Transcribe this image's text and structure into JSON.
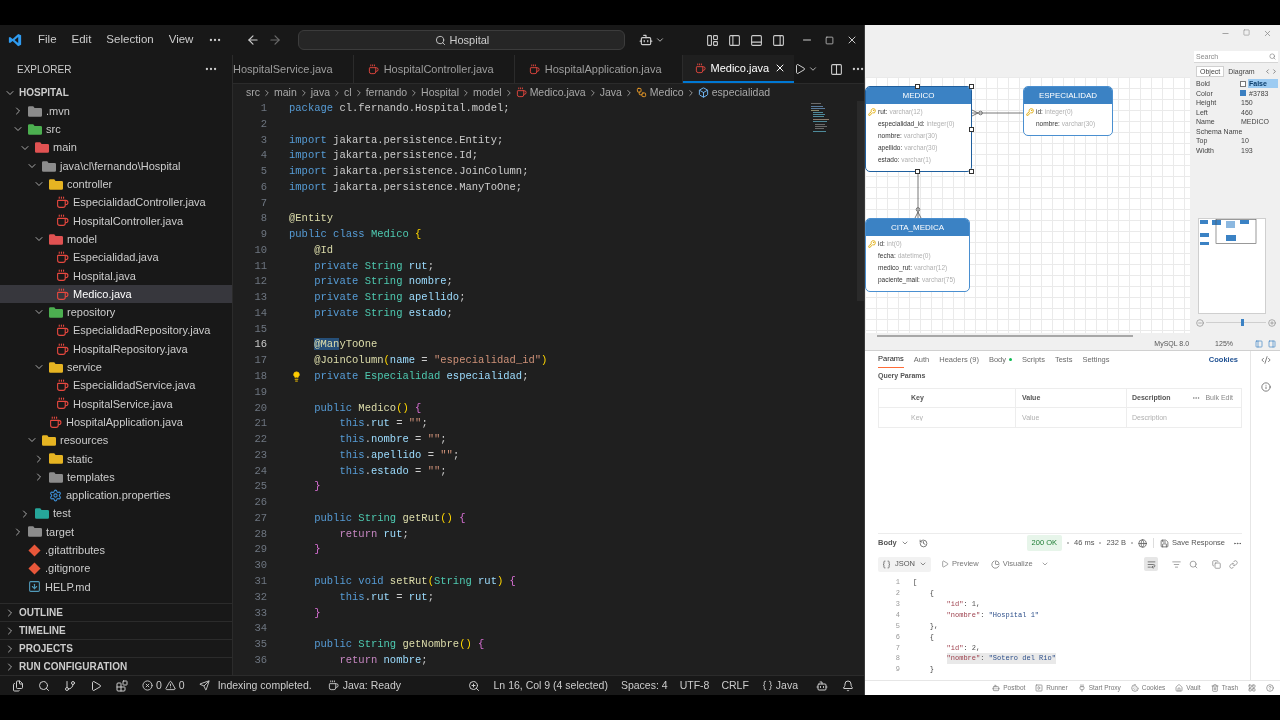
{
  "vscode": {
    "menu": [
      "File",
      "Edit",
      "Selection",
      "View"
    ],
    "command_center": "Hospital",
    "sidebar": {
      "title": "EXPLORER",
      "project": {
        "label": "HOSPITAL",
        "expanded": true
      },
      "tree": [
        {
          "label": ".mvn",
          "kind": "folder",
          "color": "#8c8c8c",
          "expanded": false,
          "selected": false
        },
        {
          "label": "src",
          "kind": "folder",
          "color": "#4caf50",
          "expanded": true,
          "selected": false,
          "children": [
            {
              "label": "main",
              "kind": "folder",
              "color": "#e05252",
              "expanded": true,
              "selected": false,
              "children": [
                {
                  "label": "java\\cl\\fernando\\Hospital",
                  "kind": "folder",
                  "color": "#8c8c8c",
                  "expanded": true,
                  "selected": false,
                  "children": [
                    {
                      "label": "controller",
                      "kind": "folder",
                      "color": "#e6b422",
                      "expanded": true,
                      "selected": false,
                      "children": [
                        {
                          "label": "EspecialidadController.java",
                          "kind": "java",
                          "selected": false
                        },
                        {
                          "label": "HospitalController.java",
                          "kind": "java",
                          "selected": false
                        }
                      ]
                    },
                    {
                      "label": "model",
                      "kind": "folder",
                      "color": "#e05252",
                      "expanded": true,
                      "selected": false,
                      "children": [
                        {
                          "label": "Especialidad.java",
                          "kind": "java",
                          "selected": false
                        },
                        {
                          "label": "Hospital.java",
                          "kind": "java",
                          "selected": false
                        },
                        {
                          "label": "Medico.java",
                          "kind": "java",
                          "selected": true
                        }
                      ]
                    },
                    {
                      "label": "repository",
                      "kind": "folder",
                      "color": "#4caf50",
                      "expanded": true,
                      "selected": false,
                      "children": [
                        {
                          "label": "EspecialidadRepository.java",
                          "kind": "java",
                          "selected": false
                        },
                        {
                          "label": "HospitalRepository.java",
                          "kind": "java",
                          "selected": false
                        }
                      ]
                    },
                    {
                      "label": "service",
                      "kind": "folder",
                      "color": "#e6b422",
                      "expanded": true,
                      "selected": false,
                      "children": [
                        {
                          "label": "EspecialidadService.java",
                          "kind": "java",
                          "selected": false
                        },
                        {
                          "label": "HospitalService.java",
                          "kind": "java",
                          "selected": false
                        }
                      ]
                    },
                    {
                      "label": "HospitalApplication.java",
                      "kind": "java",
                      "selected": false
                    }
                  ]
                },
                {
                  "label": "resources",
                  "kind": "folder",
                  "color": "#e6b422",
                  "expanded": true,
                  "selected": false,
                  "children": [
                    {
                      "label": "static",
                      "kind": "folder",
                      "color": "#e6b422",
                      "expanded": false,
                      "selected": false
                    },
                    {
                      "label": "templates",
                      "kind": "folder",
                      "color": "#8c8c8c",
                      "expanded": false,
                      "selected": false
                    },
                    {
                      "label": "application.properties",
                      "kind": "properties",
                      "selected": false
                    }
                  ]
                }
              ]
            },
            {
              "label": "test",
              "kind": "folder",
              "color": "#26a69a",
              "expanded": false,
              "selected": false
            }
          ]
        },
        {
          "label": "target",
          "kind": "folder",
          "color": "#8c8c8c",
          "expanded": false,
          "selected": false
        },
        {
          "label": ".gitattributes",
          "kind": "git",
          "selected": false
        },
        {
          "label": ".gitignore",
          "kind": "git",
          "selected": false
        },
        {
          "label": "HELP.md",
          "kind": "markdown",
          "selected": false
        }
      ],
      "sections": [
        {
          "label": "OUTLINE",
          "expanded": false
        },
        {
          "label": "TIMELINE",
          "expanded": false
        },
        {
          "label": "PROJECTS",
          "expanded": false
        },
        {
          "label": "RUN CONFIGURATION",
          "expanded": false
        }
      ]
    },
    "tabs": [
      {
        "label": "HospitalService.java",
        "selected": false,
        "partly_hidden": true
      },
      {
        "label": "HospitalController.java",
        "selected": false,
        "partly_hidden": false
      },
      {
        "label": "HospitalApplication.java",
        "selected": false,
        "partly_hidden": false
      },
      {
        "label": "Medico.java",
        "selected": true,
        "partly_hidden": false
      }
    ],
    "breadcrumb": [
      {
        "label": "src",
        "kind": "segment"
      },
      {
        "label": "main",
        "kind": "segment"
      },
      {
        "label": "java",
        "kind": "segment"
      },
      {
        "label": "cl",
        "kind": "segment"
      },
      {
        "label": "fernando",
        "kind": "segment"
      },
      {
        "label": "Hospital",
        "kind": "segment"
      },
      {
        "label": "model",
        "kind": "segment"
      },
      {
        "label": "Medico.java",
        "kind": "java"
      },
      {
        "label": "Java",
        "kind": "segment"
      },
      {
        "label": "Medico",
        "kind": "class"
      },
      {
        "label": "especialidad",
        "kind": "field"
      }
    ],
    "editor": {
      "lines": [
        {
          "number": "1",
          "active": false,
          "quick_fix": false,
          "tokens": [
            {
              "text": "package",
              "kind": "keyword"
            },
            {
              "text": " cl.fernando.Hospital.model;",
              "kind": "plain"
            }
          ]
        },
        {
          "number": "2",
          "active": false,
          "quick_fix": false
        },
        {
          "number": "3",
          "active": false,
          "quick_fix": false,
          "tokens": [
            {
              "text": "import",
              "kind": "keyword"
            },
            {
              "text": " jakarta.persistence.Entity;",
              "kind": "plain"
            }
          ]
        },
        {
          "number": "4",
          "active": false,
          "quick_fix": false,
          "tokens": [
            {
              "text": "import",
              "kind": "keyword"
            },
            {
              "text": " jakarta.persistence.Id;",
              "kind": "plain"
            }
          ]
        },
        {
          "number": "5",
          "active": false,
          "quick_fix": false,
          "tokens": [
            {
              "text": "import",
              "kind": "keyword"
            },
            {
              "text": " jakarta.persistence.JoinColumn;",
              "kind": "plain"
            }
          ]
        },
        {
          "number": "6",
          "active": false,
          "quick_fix": false,
          "tokens": [
            {
              "text": "import",
              "kind": "keyword"
            },
            {
              "text": " jakarta.persistence.ManyToOne;",
              "kind": "plain"
            }
          ]
        },
        {
          "number": "7",
          "active": false,
          "quick_fix": false
        },
        {
          "number": "8",
          "active": false,
          "quick_fix": false,
          "tokens": [
            {
              "text": "@Entity",
              "kind": "annotation"
            }
          ]
        },
        {
          "number": "9",
          "active": false,
          "quick_fix": false,
          "tokens": [
            {
              "text": "public class",
              "kind": "keyword"
            },
            {
              "text": " Medico",
              "kind": "type"
            },
            {
              "text": " {",
              "kind": "bracket"
            }
          ]
        },
        {
          "number": "10",
          "active": false,
          "quick_fix": false,
          "tokens": [
            {
              "text": "    @Id",
              "kind": "annotation"
            }
          ]
        },
        {
          "number": "11",
          "active": false,
          "quick_fix": false,
          "tokens": [
            {
              "text": "    private",
              "kind": "keyword"
            },
            {
              "text": " String",
              "kind": "type"
            },
            {
              "text": " rut",
              "kind": "variable"
            },
            {
              "text": ";",
              "kind": "plain"
            }
          ]
        },
        {
          "number": "12",
          "active": false,
          "quick_fix": false,
          "tokens": [
            {
              "text": "    private",
              "kind": "keyword"
            },
            {
              "text": " String",
              "kind": "type"
            },
            {
              "text": " nombre",
              "kind": "variable"
            },
            {
              "text": ";",
              "kind": "plain"
            }
          ]
        },
        {
          "number": "13",
          "active": false,
          "quick_fix": false,
          "tokens": [
            {
              "text": "    private",
              "kind": "keyword"
            },
            {
              "text": " String",
              "kind": "type"
            },
            {
              "text": " apellido",
              "kind": "variable"
            },
            {
              "text": ";",
              "kind": "plain"
            }
          ]
        },
        {
          "number": "14",
          "active": false,
          "quick_fix": false,
          "tokens": [
            {
              "text": "    private",
              "kind": "keyword"
            },
            {
              "text": " String",
              "kind": "type"
            },
            {
              "text": " estado",
              "kind": "variable"
            },
            {
              "text": ";",
              "kind": "plain"
            }
          ]
        },
        {
          "number": "15",
          "active": false,
          "quick_fix": false
        },
        {
          "number": "16",
          "active": true,
          "quick_fix": false,
          "tokens": [
            {
              "text": "    @Man",
              "kind": "selected"
            },
            {
              "text": "yToOne",
              "kind": "annotation"
            }
          ]
        },
        {
          "number": "17",
          "active": false,
          "quick_fix": false,
          "tokens": [
            {
              "text": "    @JoinColumn",
              "kind": "annotation"
            },
            {
              "text": "(",
              "kind": "bracket"
            },
            {
              "text": "name",
              "kind": "variable"
            },
            {
              "text": " = ",
              "kind": "plain"
            },
            {
              "text": "\"especialidad_id\"",
              "kind": "string"
            },
            {
              "text": ")",
              "kind": "bracket"
            }
          ]
        },
        {
          "number": "18",
          "active": false,
          "quick_fix": true,
          "tokens": [
            {
              "text": "    private",
              "kind": "keyword"
            },
            {
              "text": " Especialidad",
              "kind": "type"
            },
            {
              "text": " especialidad",
              "kind": "variable"
            },
            {
              "text": ";",
              "kind": "plain"
            }
          ]
        },
        {
          "number": "19",
          "active": false,
          "quick_fix": false
        },
        {
          "number": "20",
          "active": false,
          "quick_fix": false,
          "tokens": [
            {
              "text": "    public",
              "kind": "keyword"
            },
            {
              "text": " Medico",
              "kind": "function"
            },
            {
              "text": "()",
              "kind": "bracket"
            },
            {
              "text": " {",
              "kind": "bracket2"
            }
          ]
        },
        {
          "number": "21",
          "active": false,
          "quick_fix": false,
          "tokens": [
            {
              "text": "        this",
              "kind": "keyword"
            },
            {
              "text": ".",
              "kind": "plain"
            },
            {
              "text": "rut",
              "kind": "variable"
            },
            {
              "text": " = ",
              "kind": "plain"
            },
            {
              "text": "\"\"",
              "kind": "string"
            },
            {
              "text": ";",
              "kind": "plain"
            }
          ]
        },
        {
          "number": "22",
          "active": false,
          "quick_fix": false,
          "tokens": [
            {
              "text": "        this",
              "kind": "keyword"
            },
            {
              "text": ".",
              "kind": "plain"
            },
            {
              "text": "nombre",
              "kind": "variable"
            },
            {
              "text": " = ",
              "kind": "plain"
            },
            {
              "text": "\"\"",
              "kind": "string"
            },
            {
              "text": ";",
              "kind": "plain"
            }
          ]
        },
        {
          "number": "23",
          "active": false,
          "quick_fix": false,
          "tokens": [
            {
              "text": "        this",
              "kind": "keyword"
            },
            {
              "text": ".",
              "kind": "plain"
            },
            {
              "text": "apellido",
              "kind": "variable"
            },
            {
              "text": " = ",
              "kind": "plain"
            },
            {
              "text": "\"\"",
              "kind": "string"
            },
            {
              "text": ";",
              "kind": "plain"
            }
          ]
        },
        {
          "number": "24",
          "active": false,
          "quick_fix": false,
          "tokens": [
            {
              "text": "        this",
              "kind": "keyword"
            },
            {
              "text": ".",
              "kind": "plain"
            },
            {
              "text": "estado",
              "kind": "variable"
            },
            {
              "text": " = ",
              "kind": "plain"
            },
            {
              "text": "\"\"",
              "kind": "string"
            },
            {
              "text": ";",
              "kind": "plain"
            }
          ]
        },
        {
          "number": "25",
          "active": false,
          "quick_fix": false,
          "tokens": [
            {
              "text": "    }",
              "kind": "bracket2"
            }
          ]
        },
        {
          "number": "26",
          "active": false,
          "quick_fix": false
        },
        {
          "number": "27",
          "active": false,
          "quick_fix": false,
          "tokens": [
            {
              "text": "    public",
              "kind": "keyword"
            },
            {
              "text": " String",
              "kind": "type"
            },
            {
              "text": " getRut",
              "kind": "function"
            },
            {
              "text": "()",
              "kind": "bracket"
            },
            {
              "text": " {",
              "kind": "bracket2"
            }
          ]
        },
        {
          "number": "28",
          "active": false,
          "quick_fix": false,
          "tokens": [
            {
              "text": "        return",
              "kind": "control"
            },
            {
              "text": " rut",
              "kind": "variable"
            },
            {
              "text": ";",
              "kind": "plain"
            }
          ]
        },
        {
          "number": "29",
          "active": false,
          "quick_fix": false,
          "tokens": [
            {
              "text": "    }",
              "kind": "bracket2"
            }
          ]
        },
        {
          "number": "30",
          "active": false,
          "quick_fix": false
        },
        {
          "number": "31",
          "active": false,
          "quick_fix": false,
          "tokens": [
            {
              "text": "    public void",
              "kind": "keyword"
            },
            {
              "text": " setRut",
              "kind": "function"
            },
            {
              "text": "(",
              "kind": "bracket"
            },
            {
              "text": "String",
              "kind": "type"
            },
            {
              "text": " rut",
              "kind": "variable"
            },
            {
              "text": ")",
              "kind": "bracket"
            },
            {
              "text": " {",
              "kind": "bracket2"
            }
          ]
        },
        {
          "number": "32",
          "active": false,
          "quick_fix": false,
          "tokens": [
            {
              "text": "        this",
              "kind": "keyword"
            },
            {
              "text": ".",
              "kind": "plain"
            },
            {
              "text": "rut",
              "kind": "variable"
            },
            {
              "text": " = ",
              "kind": "plain"
            },
            {
              "text": "rut",
              "kind": "variable"
            },
            {
              "text": ";",
              "kind": "plain"
            }
          ]
        },
        {
          "number": "33",
          "active": false,
          "quick_fix": false,
          "tokens": [
            {
              "text": "    }",
              "kind": "bracket2"
            }
          ]
        },
        {
          "number": "34",
          "active": false,
          "quick_fix": false
        },
        {
          "number": "35",
          "active": false,
          "quick_fix": false,
          "tokens": [
            {
              "text": "    public",
              "kind": "keyword"
            },
            {
              "text": " String",
              "kind": "type"
            },
            {
              "text": " getNombre",
              "kind": "function"
            },
            {
              "text": "()",
              "kind": "bracket"
            },
            {
              "text": " {",
              "kind": "bracket2"
            }
          ]
        },
        {
          "number": "36",
          "active": false,
          "quick_fix": false,
          "tokens": [
            {
              "text": "        return",
              "kind": "control"
            },
            {
              "text": " nombre",
              "kind": "variable"
            },
            {
              "text": ";",
              "kind": "plain"
            }
          ]
        }
      ]
    },
    "status_bar": {
      "errors": "0",
      "warnings": "0",
      "message": "Indexing completed.",
      "java_status": "Java: Ready",
      "position": "Ln 16, Col 9 (4 selected)",
      "indentation": "Spaces: 4",
      "encoding": "UTF-8",
      "line_ending": "CRLF",
      "language": "Java"
    }
  },
  "er_diagram": {
    "tables": [
      {
        "name": "MEDICO",
        "selected": true,
        "fields": [
          {
            "name": "rut:",
            "type": "varchar(12)",
            "primary_key": true
          },
          {
            "name": "especialidad_id:",
            "type": "integer(0)",
            "primary_key": false
          },
          {
            "name": "nombre:",
            "type": "varchar(30)",
            "primary_key": false
          },
          {
            "name": "apellido:",
            "type": "varchar(30)",
            "primary_key": false
          },
          {
            "name": "estado:",
            "type": "varchar(1)",
            "primary_key": false
          }
        ]
      },
      {
        "name": "ESPECIALIDAD",
        "selected": false,
        "fields": [
          {
            "name": "id:",
            "type": "integer(0)",
            "primary_key": true
          },
          {
            "name": "nombre:",
            "type": "varchar(30)",
            "primary_key": false
          }
        ]
      },
      {
        "name": "CITA_MEDICA",
        "selected": false,
        "fields": [
          {
            "name": "id:",
            "type": "int(0)",
            "primary_key": true
          },
          {
            "name": "fecha:",
            "type": "datetime(0)",
            "primary_key": false
          },
          {
            "name": "medico_rut:",
            "type": "varchar(12)",
            "primary_key": false
          },
          {
            "name": "paciente_mail:",
            "type": "varchar(75)",
            "primary_key": false
          }
        ]
      }
    ],
    "search": {
      "placeholder": "Search"
    },
    "panel_tabs": [
      {
        "label": "Object",
        "selected": true
      },
      {
        "label": "Diagram",
        "selected": false
      }
    ],
    "properties": [
      {
        "name": "Bold",
        "value": "False",
        "kind": "checkbox",
        "checked": false,
        "selected": true
      },
      {
        "name": "Color",
        "value": "#3783",
        "kind": "color",
        "color": "#3a7fc1",
        "selected": false
      },
      {
        "name": "Height",
        "value": "150",
        "kind": "text",
        "selected": false
      },
      {
        "name": "Left",
        "value": "460",
        "kind": "text",
        "selected": false
      },
      {
        "name": "Name",
        "value": "MEDICO",
        "kind": "text",
        "selected": false
      },
      {
        "name": "Schema Name",
        "kind": "text",
        "selected": false
      },
      {
        "name": "Top",
        "value": "10",
        "kind": "text",
        "selected": false
      },
      {
        "name": "Width",
        "value": "193",
        "kind": "text",
        "selected": false
      }
    ],
    "zoom_slider": {
      "level": 0.6
    },
    "status": {
      "database": "MySQL 8.0",
      "zoom": "125%"
    }
  },
  "postman": {
    "request_tabs": [
      {
        "label": "Params",
        "selected": true,
        "indicator": false
      },
      {
        "label": "Auth",
        "selected": false,
        "indicator": false
      },
      {
        "label": "Headers (9)",
        "selected": false,
        "indicator": false
      },
      {
        "label": "Body",
        "selected": false,
        "indicator": true
      },
      {
        "label": "Scripts",
        "selected": false,
        "indicator": false
      },
      {
        "label": "Tests",
        "selected": false,
        "indicator": false
      },
      {
        "label": "Settings",
        "selected": false,
        "indicator": false
      }
    ],
    "cookies": "Cookies",
    "query_params": {
      "title": "Query Params",
      "columns": [
        "Key",
        "Value",
        "Description"
      ],
      "bulk_edit": "Bulk Edit",
      "placeholders": [
        "Key",
        "Value",
        "Description"
      ]
    },
    "response": {
      "view": "Body",
      "status": "200 OK",
      "time": "46 ms",
      "size": "232 B",
      "save": "Save Response",
      "format": "JSON",
      "preview": "Preview",
      "visualize": "Visualize",
      "word_wrap": true,
      "lines": [
        {
          "number": "1",
          "selected": false,
          "tokens": [
            {
              "text": "[",
              "kind": "plain"
            }
          ]
        },
        {
          "number": "2",
          "selected": false,
          "tokens": [
            {
              "text": "    {",
              "kind": "plain"
            }
          ]
        },
        {
          "number": "3",
          "selected": false,
          "tokens": [
            {
              "text": "        \"id\"",
              "kind": "key"
            },
            {
              "text": ": ",
              "kind": "plain"
            },
            {
              "text": "1",
              "kind": "number"
            },
            {
              "text": ",",
              "kind": "plain"
            }
          ]
        },
        {
          "number": "4",
          "selected": false,
          "tokens": [
            {
              "text": "        \"nombre\"",
              "kind": "key"
            },
            {
              "text": ": ",
              "kind": "plain"
            },
            {
              "text": "\"Hospital 1\"",
              "kind": "string"
            }
          ]
        },
        {
          "number": "5",
          "selected": false,
          "tokens": [
            {
              "text": "    },",
              "kind": "plain"
            }
          ]
        },
        {
          "number": "6",
          "selected": false,
          "tokens": [
            {
              "text": "    {",
              "kind": "plain"
            }
          ]
        },
        {
          "number": "7",
          "selected": false,
          "tokens": [
            {
              "text": "        \"id\"",
              "kind": "key"
            },
            {
              "text": ": ",
              "kind": "plain"
            },
            {
              "text": "2",
              "kind": "number"
            },
            {
              "text": ",",
              "kind": "plain"
            }
          ]
        },
        {
          "number": "8",
          "selected": true,
          "tokens": [
            {
              "text": "        \"nombre\"",
              "kind": "key"
            },
            {
              "text": ": ",
              "kind": "plain"
            },
            {
              "text": "\"Sotero del Rio\"",
              "kind": "string"
            }
          ]
        },
        {
          "number": "9",
          "selected": false,
          "tokens": [
            {
              "text": "    }",
              "kind": "plain"
            }
          ]
        }
      ]
    },
    "footer": [
      "Postbot",
      "Runner",
      "Start Proxy",
      "Cookies",
      "Vault",
      "Trash"
    ]
  }
}
